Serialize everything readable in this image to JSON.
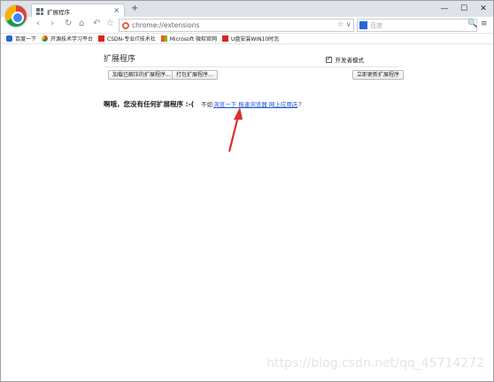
{
  "tab": {
    "title": "扩展程序",
    "close": "×",
    "new": "+"
  },
  "window_controls": {
    "minimize": "—",
    "maximize": "☐",
    "close": "✕"
  },
  "nav": {
    "back": "‹",
    "forward": "›",
    "reload": "↻",
    "home": "⌂",
    "undo": "↶",
    "bookmark": "☆"
  },
  "address": {
    "url": "chrome://extensions",
    "right_icons": "☆ ∨"
  },
  "search": {
    "placeholder": "百度",
    "mag": "🔍"
  },
  "menu": "≡",
  "bookmarks": [
    {
      "label": "百度一下",
      "icon": "baidu-icon"
    },
    {
      "label": "开源技术学习平台",
      "icon": "chrome-icon"
    },
    {
      "label": "CSDN-专业IT技术社",
      "icon": "csdn-icon"
    },
    {
      "label": "Microsoft 微软官网",
      "icon": "microsoft-icon"
    },
    {
      "label": "U盘安装WIN10时怎",
      "icon": "csdn-icon"
    }
  ],
  "extensions": {
    "title": "扩展程序",
    "dev_mode_label": "开发者模式",
    "dev_mode_checked": true,
    "load_unpacked": "加载已解压的扩展程序...",
    "pack": "打包扩展程序...",
    "update": "立即更新扩展程序",
    "empty_strong": "啊哦，您没有任何扩展程序 :-(",
    "empty_pre": "不如",
    "empty_link": "浏览一下 极速浏览器 网上应用店",
    "empty_q": "？"
  },
  "watermark": "https://blog.csdn.net/qq_45714272",
  "colors": {
    "link": "#1a53d6",
    "annotation_arrow": "#e32b2b"
  }
}
